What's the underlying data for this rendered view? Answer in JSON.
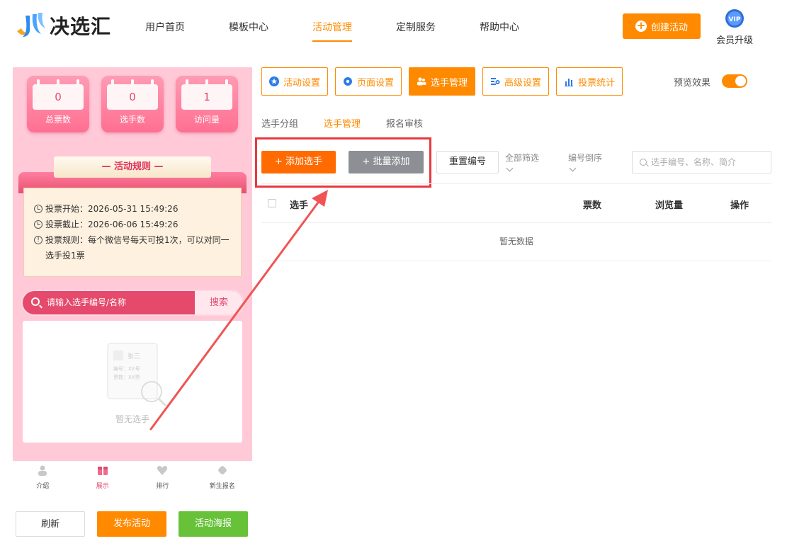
{
  "brand": {
    "name": "决选汇",
    "primary": "#ff8a00",
    "highlight": "#e8393f"
  },
  "nav": {
    "items": [
      {
        "label": "用户首页",
        "active": false
      },
      {
        "label": "模板中心",
        "active": false
      },
      {
        "label": "活动管理",
        "active": true
      },
      {
        "label": "定制服务",
        "active": false
      },
      {
        "label": "帮助中心",
        "active": false
      }
    ],
    "create_label": "创建活动",
    "vip_label": "会员升级",
    "vip_badge": "VIP"
  },
  "preview": {
    "stats": [
      {
        "value": "0",
        "label": "总票数"
      },
      {
        "value": "0",
        "label": "选手数"
      },
      {
        "value": "1",
        "label": "访问量"
      }
    ],
    "rules_title": "— 活动规则 —",
    "rules": {
      "start": "投票开始：2026-05-31 15:49:26",
      "end": "投票截止：2026-06-06 15:49:26",
      "rule": "投票规则：每个微信号每天可投1次，可以对同一选手投1票"
    },
    "search_placeholder": "请输入选手编号/名称",
    "search_button": "搜索",
    "empty_card_name": "张三",
    "empty_card_line1": "编号：XX号",
    "empty_card_line2": "票数：XX票",
    "empty_text": "暂无选手",
    "tabs": [
      {
        "label": "介绍",
        "icon": "person-icon",
        "active": false
      },
      {
        "label": "展示",
        "icon": "gift-icon",
        "active": true
      },
      {
        "label": "排行",
        "icon": "heart-icon",
        "active": false
      },
      {
        "label": "新生报名",
        "icon": "tag-icon",
        "active": false
      }
    ]
  },
  "bottom_buttons": {
    "refresh": "刷新",
    "publish": "发布活动",
    "poster": "活动海报"
  },
  "toolbar": {
    "items": [
      {
        "label": "活动设置",
        "icon": "star-icon",
        "active": false
      },
      {
        "label": "页面设置",
        "icon": "gear-icon",
        "active": false
      },
      {
        "label": "选手管理",
        "icon": "users-icon",
        "active": true
      },
      {
        "label": "高级设置",
        "icon": "settings-icon",
        "active": false
      },
      {
        "label": "投票统计",
        "icon": "bar-chart-icon",
        "active": false
      }
    ],
    "preview_label": "预览效果",
    "preview_on": true
  },
  "subtabs": [
    {
      "label": "选手分组",
      "active": false
    },
    {
      "label": "选手管理",
      "active": true
    },
    {
      "label": "报名审核",
      "active": false
    }
  ],
  "actions": {
    "add": "+ 添加选手",
    "batch": "+ 批量添加",
    "reset": "重置编号",
    "filter": "全部筛选",
    "sort": "编号倒序",
    "search_placeholder": "选手编号、名称、简介"
  },
  "table": {
    "columns": [
      "选手",
      "票数",
      "浏览量",
      "操作"
    ],
    "empty": "暂无数据"
  }
}
